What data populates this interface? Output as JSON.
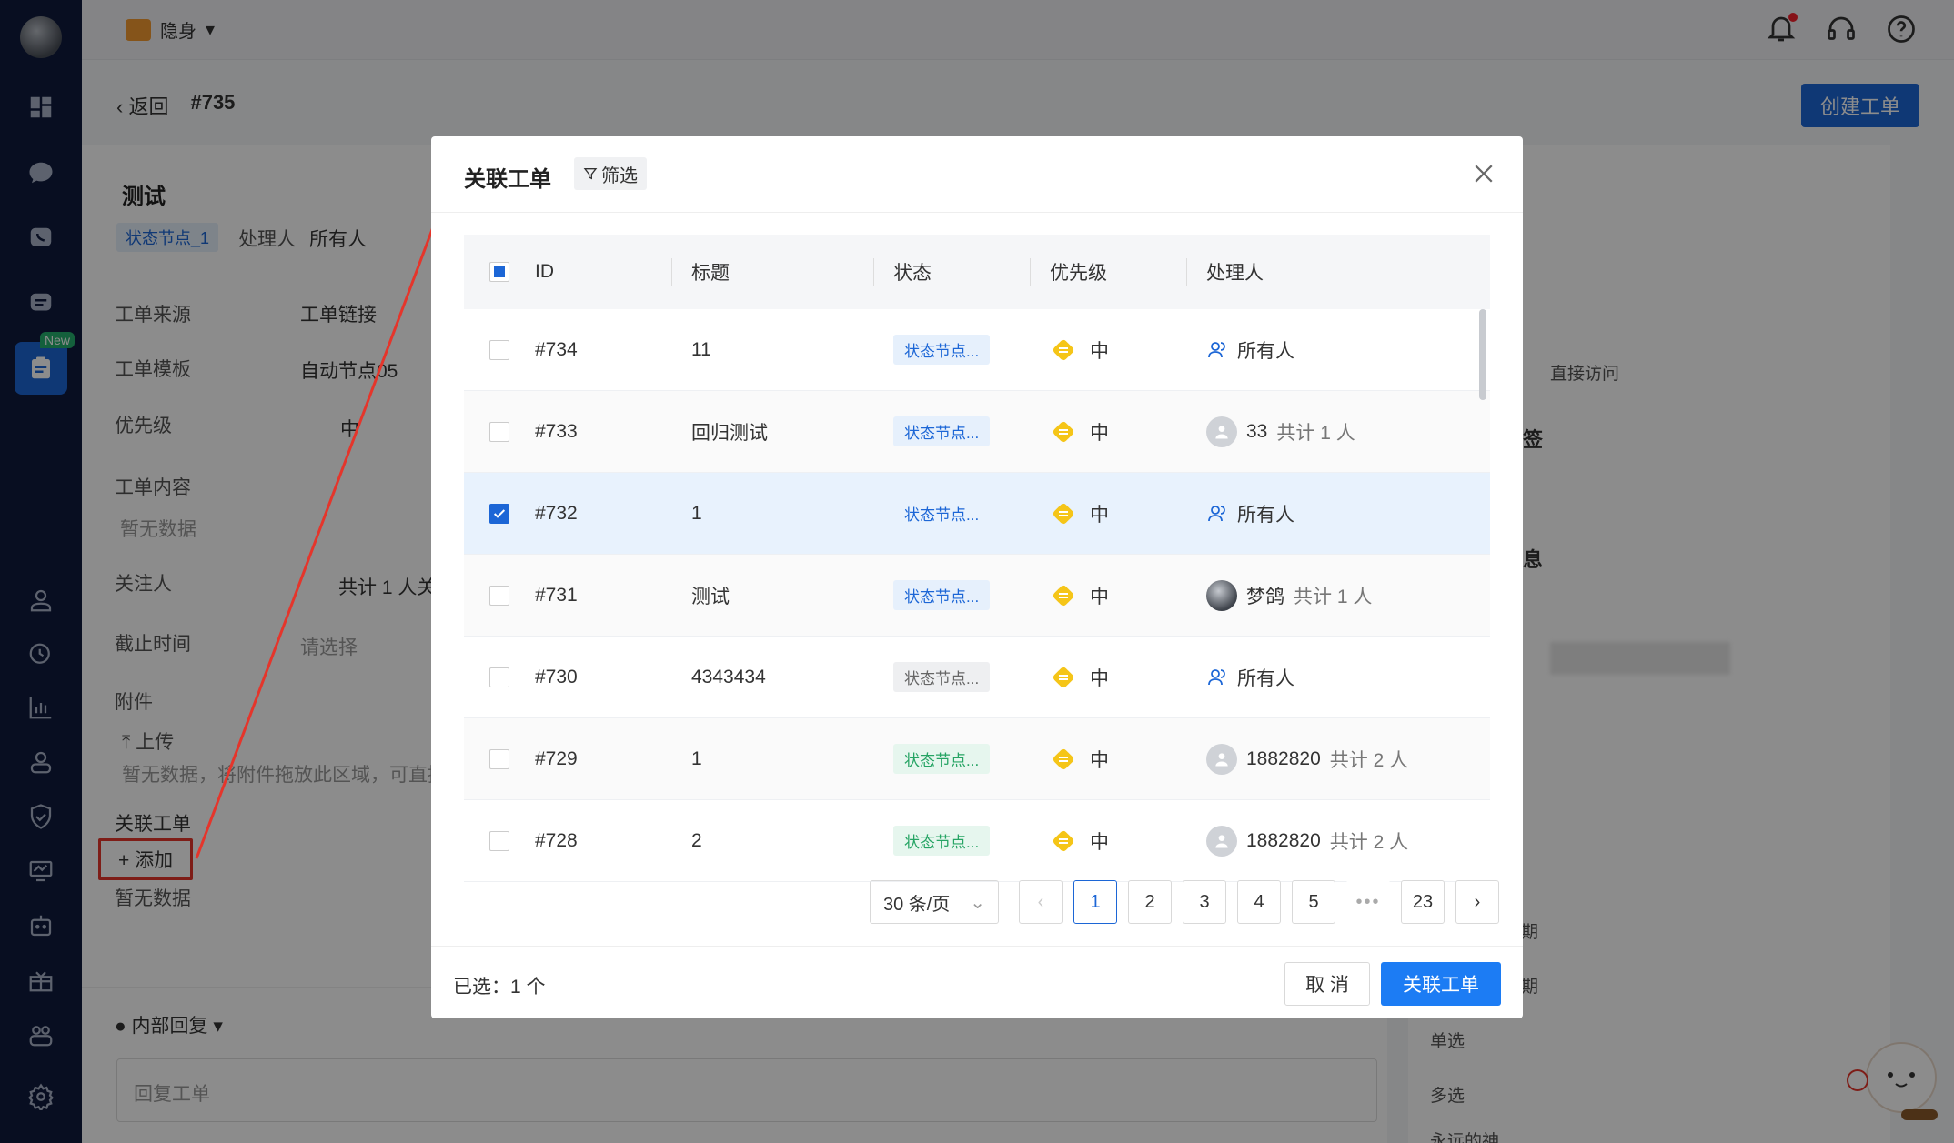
{
  "topbar": {
    "status": "隐身"
  },
  "page": {
    "back": "返回",
    "ticket_id": "#735",
    "create_button": "创建工单",
    "title": "测试",
    "node_tag": "状态节点_1",
    "handler_label": "处理人",
    "handler_value": "所有人",
    "fields": [
      {
        "label": "工单来源",
        "value": "工单链接"
      },
      {
        "label": "工单模板",
        "value": "自动节点05"
      },
      {
        "label": "优先级",
        "value": "中"
      },
      {
        "label": "工单内容",
        "value": "暂无数据"
      },
      {
        "label": "关注人",
        "value": "共计 1 人关"
      },
      {
        "label": "截止时间",
        "value": "请选择"
      },
      {
        "label": "附件",
        "value": "上传"
      }
    ],
    "attach_hint": "暂无数据，将附件拖放此区域，可直接",
    "related_label": "关联工单",
    "add_label": "+ 添加",
    "related_empty": "暂无数据",
    "reply_mode": "内部回复",
    "reply_placeholder": "回复工单",
    "right_panel": {
      "direct_access": "直接访问",
      "sign": "签",
      "info": "息",
      "single": "单选",
      "multi": "多选",
      "forever": "永远的神",
      "ji1": "期",
      "ji2": "期"
    }
  },
  "modal": {
    "title": "关联工单",
    "filter": "筛选",
    "columns": [
      "ID",
      "标题",
      "状态",
      "优先级",
      "处理人"
    ],
    "rows": [
      {
        "id": "#734",
        "title": "11",
        "status": "状态节点...",
        "status_style": "blue",
        "priority": "中",
        "assignee_type": "all",
        "assignee": "所有人",
        "extra": "",
        "checked": false
      },
      {
        "id": "#733",
        "title": "回归测试",
        "status": "状态节点...",
        "status_style": "blue",
        "priority": "中",
        "assignee_type": "user",
        "assignee": "33",
        "extra": "共计 1 人",
        "checked": false
      },
      {
        "id": "#732",
        "title": "1",
        "status": "状态节点...",
        "status_style": "plain",
        "priority": "中",
        "assignee_type": "all",
        "assignee": "所有人",
        "extra": "",
        "checked": true
      },
      {
        "id": "#731",
        "title": "测试",
        "status": "状态节点...",
        "status_style": "blue",
        "priority": "中",
        "assignee_type": "photo",
        "assignee": "梦鸽",
        "extra": "共计 1 人",
        "checked": false
      },
      {
        "id": "#730",
        "title": "4343434",
        "status": "状态节点...",
        "status_style": "grey",
        "priority": "中",
        "assignee_type": "all",
        "assignee": "所有人",
        "extra": "",
        "checked": false
      },
      {
        "id": "#729",
        "title": "1",
        "status": "状态节点...",
        "status_style": "green",
        "priority": "中",
        "assignee_type": "user",
        "assignee": "1882820",
        "extra": "共计 2 人",
        "checked": false
      },
      {
        "id": "#728",
        "title": "2",
        "status": "状态节点...",
        "status_style": "green",
        "priority": "中",
        "assignee_type": "user",
        "assignee": "1882820",
        "extra": "共计 2 人",
        "checked": false
      }
    ],
    "pagination": {
      "page_size": "30 条/页",
      "pages": [
        "1",
        "2",
        "3",
        "4",
        "5"
      ],
      "ellipsis": "•••",
      "last": "23",
      "current": "1"
    },
    "selected_text": "已选：1 个",
    "cancel": "取 消",
    "confirm": "关联工单"
  },
  "colors": {
    "primary": "#1c66d6",
    "sidebar": "#0f1b3d",
    "priority": "#f5c518",
    "annotation": "#e5352b"
  }
}
